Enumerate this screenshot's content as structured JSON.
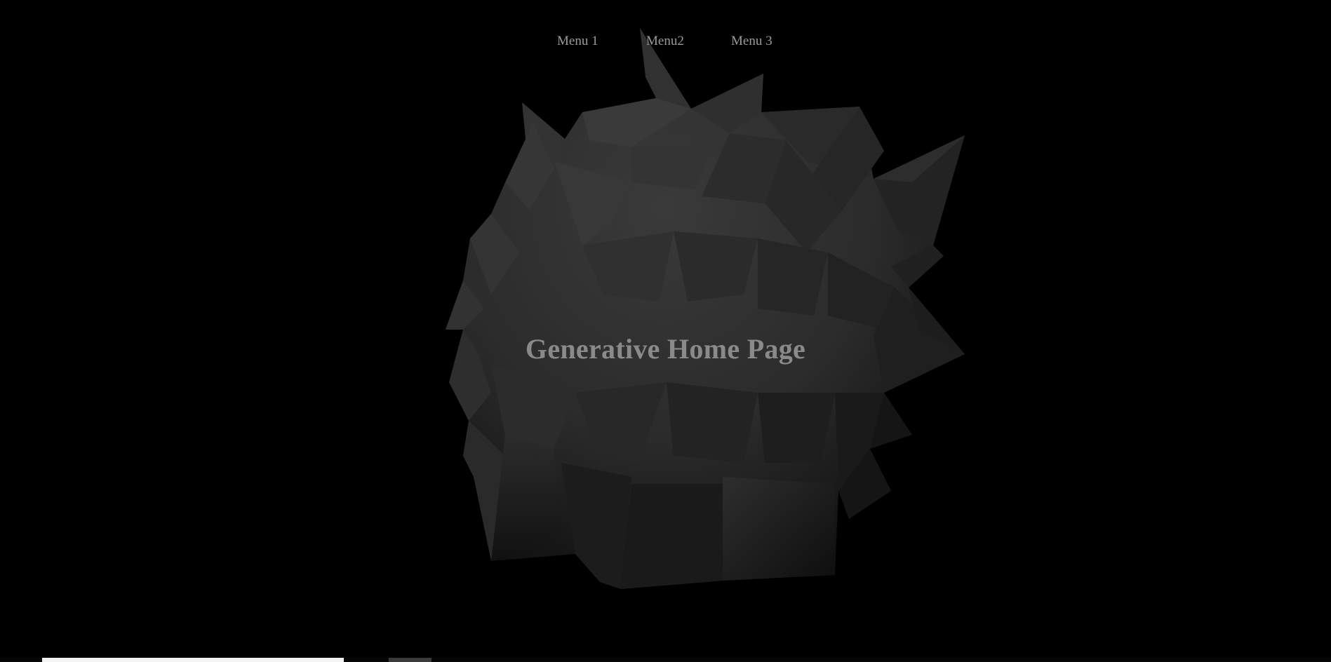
{
  "nav": {
    "items": [
      {
        "label": "Menu 1"
      },
      {
        "label": "Menu2"
      },
      {
        "label": "Menu 3"
      }
    ]
  },
  "hero": {
    "title": "Generative Home Page"
  },
  "colors": {
    "background": "#000000",
    "nav_text": "#9a9a9a",
    "title_text": "#8a8a8a",
    "shape_light": "#3a3a3a",
    "shape_dark": "#141414"
  }
}
